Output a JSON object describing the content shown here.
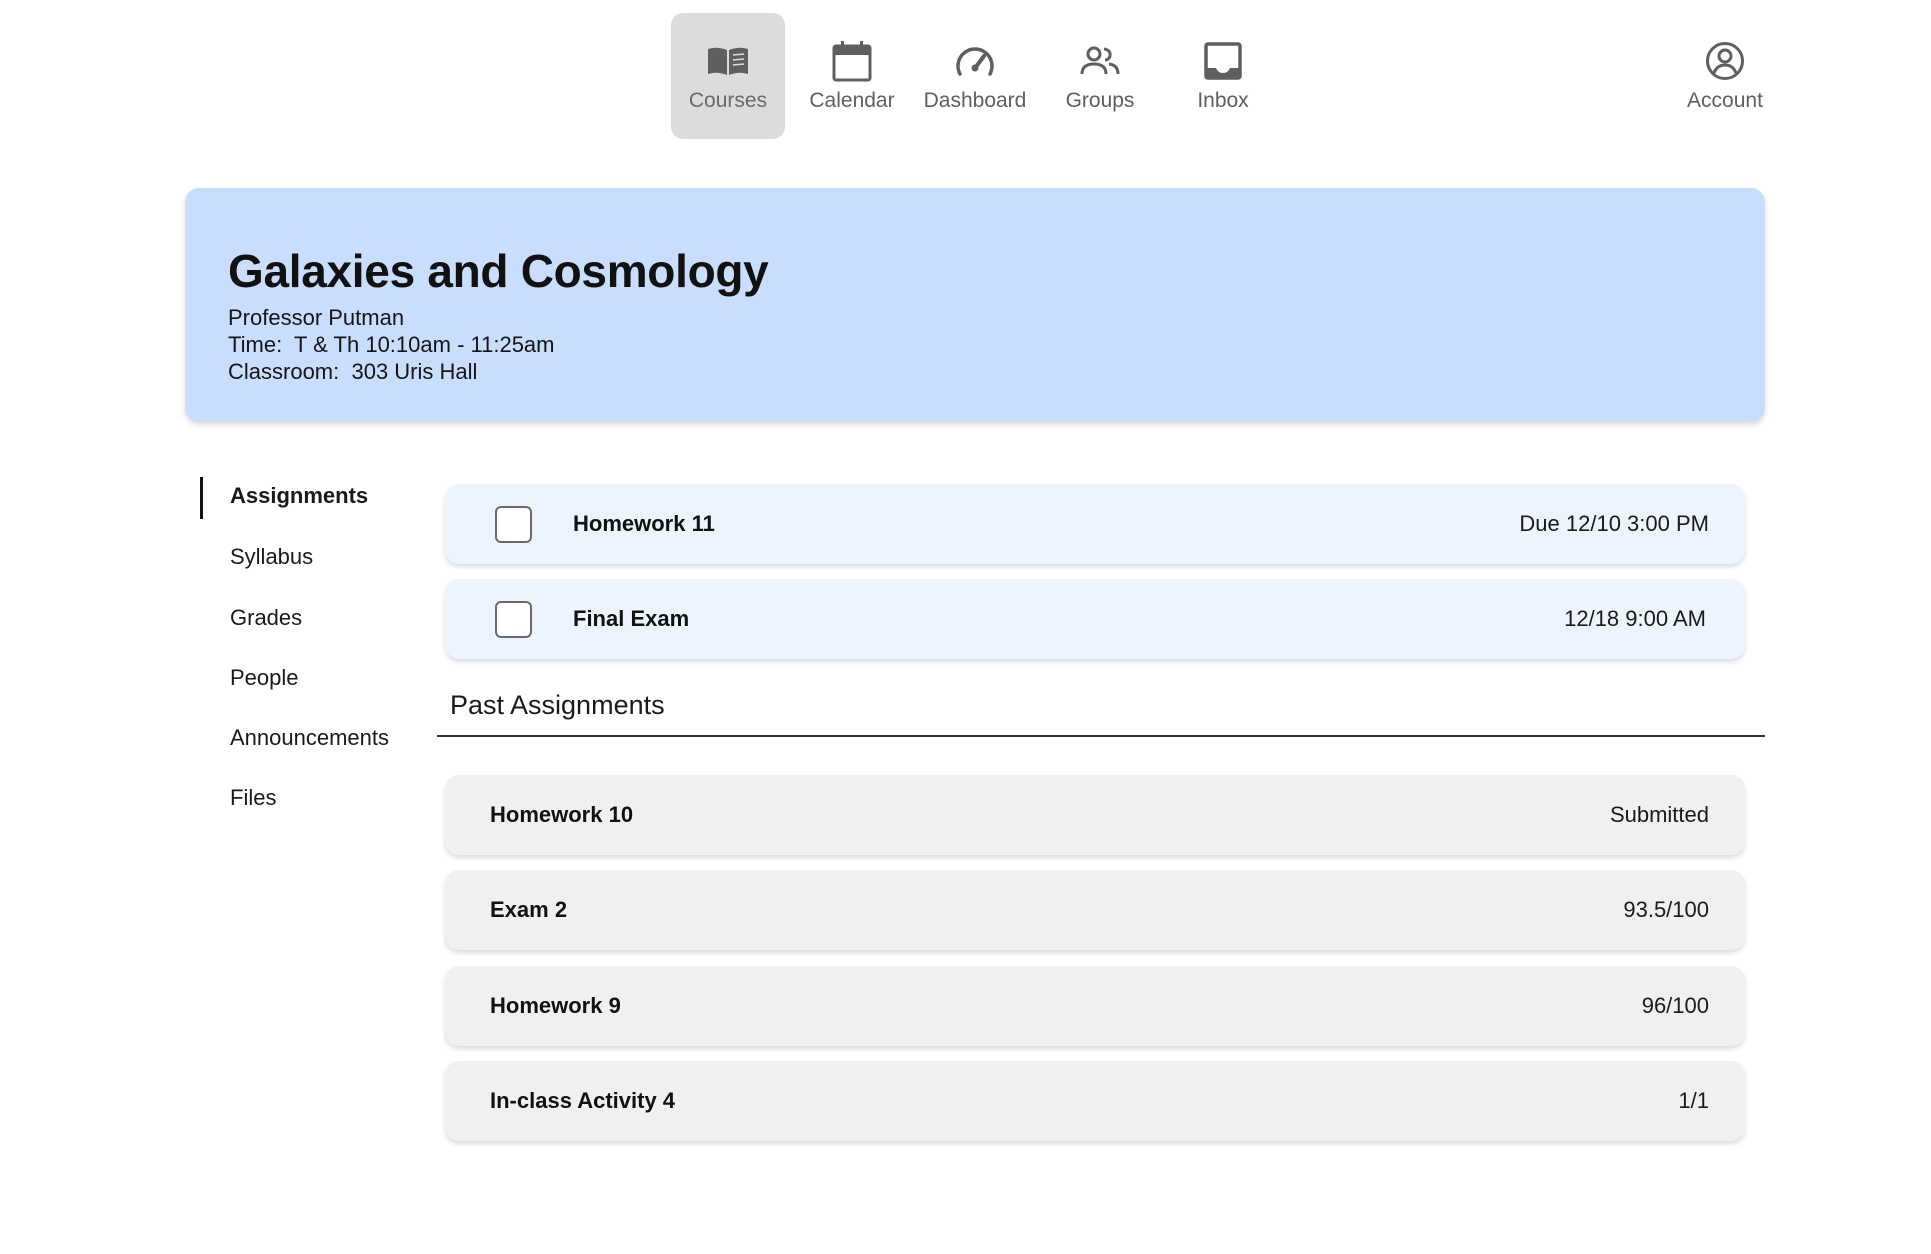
{
  "topnav": {
    "items": [
      {
        "label": "Courses",
        "icon": "book-icon",
        "active": true
      },
      {
        "label": "Calendar",
        "icon": "calendar-icon",
        "active": false
      },
      {
        "label": "Dashboard",
        "icon": "speedometer-icon",
        "active": false
      },
      {
        "label": "Groups",
        "icon": "people-icon",
        "active": false
      },
      {
        "label": "Inbox",
        "icon": "inbox-icon",
        "active": false
      }
    ],
    "account": {
      "label": "Account",
      "icon": "account-icon"
    }
  },
  "course": {
    "title": "Galaxies and Cosmology",
    "professor": "Professor Putman",
    "time": "Time:  T & Th 10:10am - 11:25am",
    "classroom": "Classroom:  303 Uris Hall"
  },
  "sidenav": {
    "items": [
      {
        "label": "Assignments",
        "active": true
      },
      {
        "label": "Syllabus",
        "active": false
      },
      {
        "label": "Grades",
        "active": false
      },
      {
        "label": "People",
        "active": false
      },
      {
        "label": "Announcements",
        "active": false
      },
      {
        "label": "Files",
        "active": false
      }
    ]
  },
  "upcoming": [
    {
      "title": "Homework 11",
      "due": "Due 12/10 3:00 PM",
      "checked": false
    },
    {
      "title": "Final Exam",
      "due": "12/18 9:00 AM",
      "checked": false
    }
  ],
  "past": {
    "heading": "Past Assignments",
    "items": [
      {
        "title": "Homework 10",
        "status": "Submitted"
      },
      {
        "title": "Exam 2",
        "status": "93.5/100"
      },
      {
        "title": "Homework 9",
        "status": "96/100"
      },
      {
        "title": "In-class Activity 4",
        "status": "1/1"
      }
    ]
  },
  "colors": {
    "header_bg": "#c9ddfd",
    "upcoming_card_bg": "#eef4fe",
    "past_card_bg": "#f0f0f0",
    "active_nav_bg": "#dcdcdc",
    "icon_gray": "#5f5f5f"
  }
}
